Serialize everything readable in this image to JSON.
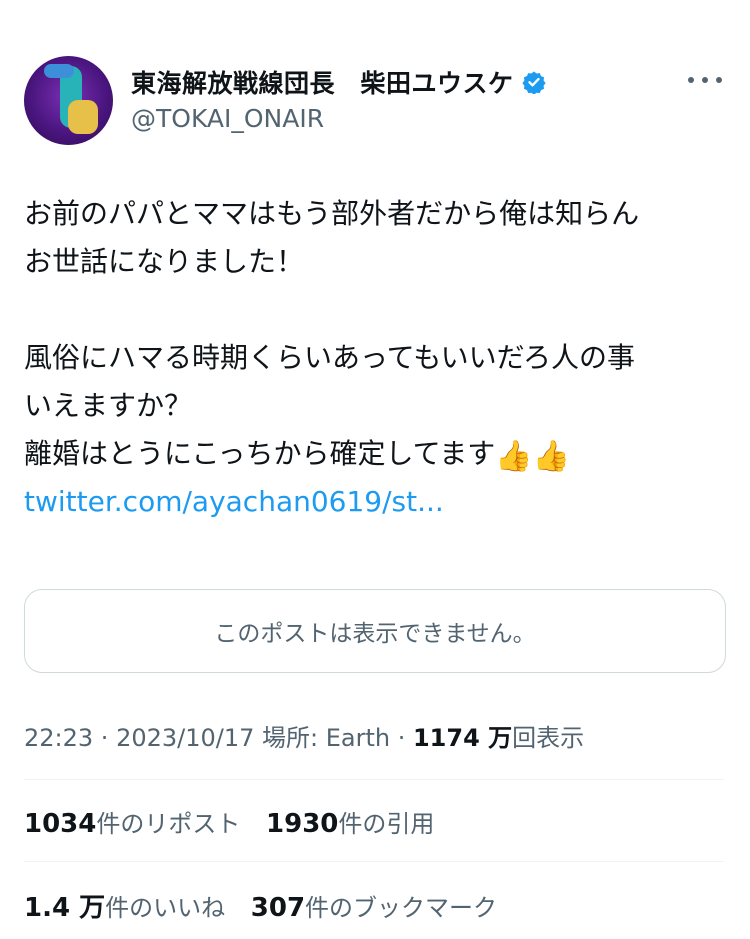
{
  "author": {
    "display_name": "東海解放戦線団長　柴田ユウスケ",
    "handle": "@TOKAI_ONAIR",
    "verified_color": "#1d9bf0"
  },
  "tweet": {
    "lines": [
      "お前のパパとママはもう部外者だから俺は知らん",
      "お世話になりました！",
      "風俗にハマる時期くらいあってもいいだろ人の事",
      "いえますか？",
      "離婚はとうにこっちから確定してます"
    ],
    "emoji": "👍👍",
    "link_text": "twitter.com/ayachan0619/st..."
  },
  "quote_unavailable": "このポストは表示できません。",
  "meta": {
    "time": "22:23",
    "separator": " · ",
    "date": "2023/10/17",
    "location": " 場所: Earth",
    "views_count": "1174 万",
    "views_label": "回表示"
  },
  "stats_row1": {
    "reposts_count": "1034",
    "reposts_label": "件のリポスト",
    "quotes_count": "1930",
    "quotes_label": "件の引用"
  },
  "stats_row2": {
    "likes_count": "1.4 万",
    "likes_label": "件のいいね",
    "bookmarks_count": "307",
    "bookmarks_label": "件のブックマーク"
  }
}
